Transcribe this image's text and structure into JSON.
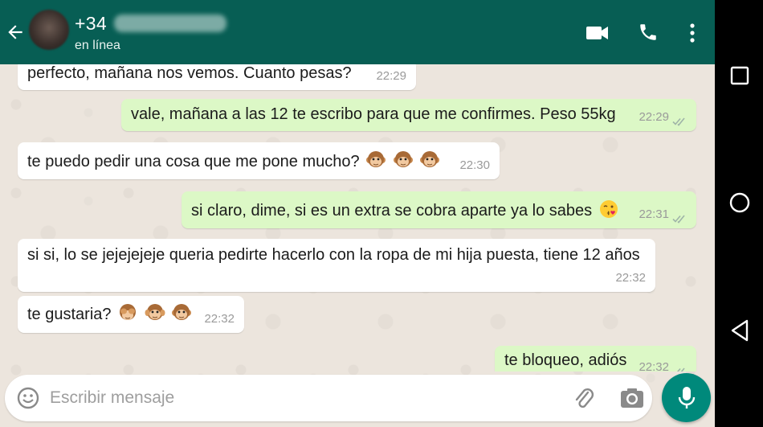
{
  "header": {
    "contact_name": "+34",
    "status": "en línea",
    "back_icon": "arrow-left-icon",
    "icons": [
      "video-call-icon",
      "phone-icon",
      "more-vertical-icon"
    ]
  },
  "messages": [
    {
      "direction": "in",
      "text": "perfecto, mañana nos vemos. Cuanto pesas?",
      "time": "22:29"
    },
    {
      "direction": "out",
      "text": "vale, mañana a las 12 te escribo para que me confirmes. Peso 55kg",
      "time": "22:29",
      "status": "read"
    },
    {
      "direction": "in",
      "text": "te puedo pedir una cosa que me pone mucho?",
      "emoji": [
        "monkey-face",
        "monkey-face",
        "monkey-face"
      ],
      "time": "22:30"
    },
    {
      "direction": "out",
      "text": "si claro, dime, si es un extra se cobra aparte ya lo sabes",
      "emoji": [
        "kissing-face-wink"
      ],
      "time": "22:31",
      "status": "read"
    },
    {
      "direction": "in",
      "text": "si si, lo se jejejejeje queria pedirte hacerlo con la ropa de mi hija puesta, tiene 12 años",
      "time": "22:32"
    },
    {
      "direction": "in",
      "text": "te gustaria?",
      "emoji": [
        "see-no-evil-monkey",
        "hear-no-evil-monkey",
        "monkey-face"
      ],
      "time": "22:32"
    },
    {
      "direction": "out",
      "text": "te bloqueo, adiós",
      "time": "22:32",
      "status": "read"
    }
  ],
  "composer": {
    "placeholder": "Escribir mensaje",
    "value": "",
    "icons": [
      "smiley-icon",
      "paperclip-icon",
      "camera-icon",
      "microphone-icon"
    ]
  },
  "colors": {
    "header": "#075e54",
    "incoming_bubble": "#ffffff",
    "outgoing_bubble": "#dcf8c6",
    "mic_button": "#00897b",
    "read_ticks": "#4fc3f7"
  },
  "system_nav": [
    "recents-square-icon",
    "home-circle-icon",
    "back-triangle-icon"
  ]
}
